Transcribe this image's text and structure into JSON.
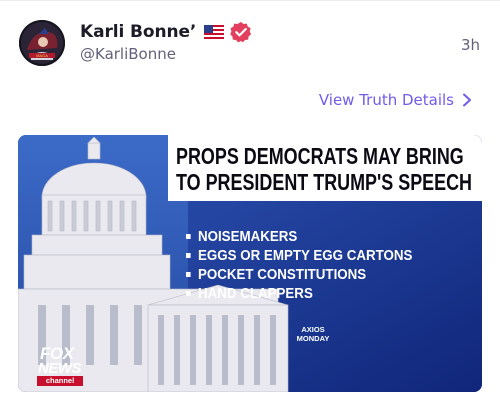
{
  "post": {
    "display_name": "Karli Bonne’",
    "handle": "@KarliBonne",
    "time": "3h",
    "details_link": "View Truth Details",
    "flag_icon": "us-flag-icon",
    "verified_icon": "verified-badge-icon",
    "verified_color": "#e3405f",
    "link_color": "#6f5ce8"
  },
  "media": {
    "headline": [
      "PROPS DEMOCRATS MAY BRING",
      "TO PRESIDENT TRUMP'S SPEECH"
    ],
    "items": [
      "NOISEMAKERS",
      "EGGS OR EMPTY EGG CARTONS",
      "POCKET CONSTITUTIONS",
      "HAND CLAPPERS"
    ],
    "source": [
      "AXIOS",
      "MONDAY"
    ],
    "logo": {
      "line1": "FOX",
      "line2": "NEWS",
      "line3": "channel"
    }
  }
}
